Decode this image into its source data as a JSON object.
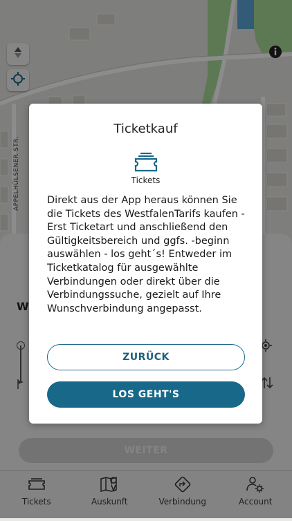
{
  "map": {
    "street_label": "APPELHÜLSENER STR."
  },
  "sheet": {
    "heading": "W",
    "next_label": "WEITER"
  },
  "dialog": {
    "title": "Ticketkauf",
    "icon_label": "Tickets",
    "body": "Direkt aus der App heraus können Sie die Tickets des WestfalenTarifs kaufen - Erst Ticketart und anschließend den Gültigkeitsbereich und ggfs. -beginn auswählen - los geht´s! Entweder im Ticketkatalog für ausgewählte Verbindungen oder direkt über die Verbindungssuche, gezielt auf Ihre Wunschverbindung angepasst.",
    "back_label": "ZURÜCK",
    "go_label": "LOS GEHT'S"
  },
  "nav": {
    "items": [
      {
        "label": "Tickets",
        "icon": "ticket-icon"
      },
      {
        "label": "Auskunft",
        "icon": "map-pin-icon"
      },
      {
        "label": "Verbindung",
        "icon": "route-sign-icon"
      },
      {
        "label": "Account",
        "icon": "account-settings-icon"
      }
    ]
  },
  "colors": {
    "primary": "#176889",
    "overlay": "rgba(0,0,0,0.45)",
    "water": "#5aa6d8",
    "greenery": "#8fd07a"
  }
}
